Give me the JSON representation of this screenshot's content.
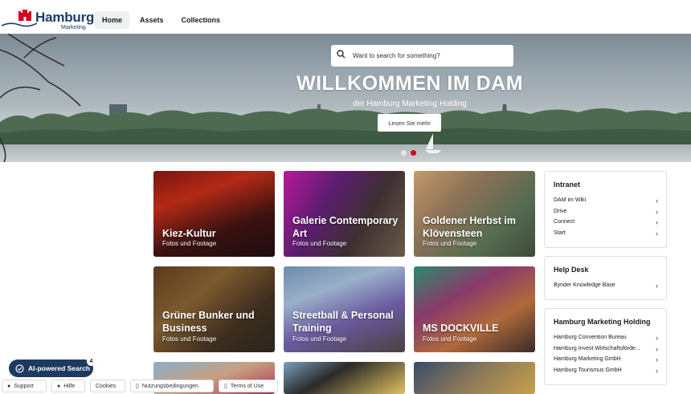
{
  "header": {
    "logo_text": "Hamburg",
    "logo_subtext": "Marketing",
    "nav": [
      {
        "label": "Home",
        "active": true
      },
      {
        "label": "Assets",
        "active": false
      },
      {
        "label": "Collections",
        "active": false
      }
    ]
  },
  "hero": {
    "search_placeholder": "Want to search for something?",
    "title": "WILLKOMMEN IM DAM",
    "subtitle": "der Hamburg Marketing Holding",
    "button_label": "Lesen Sie mehr",
    "carousel_dots": 2,
    "active_dot": 2
  },
  "cards": [
    {
      "title": "Kiez-Kultur",
      "subtitle": "Fotos und Footage"
    },
    {
      "title": "Galerie Contemporary Art",
      "subtitle": "Fotos und Footage"
    },
    {
      "title": "Goldener Herbst im Klövensteen",
      "subtitle": "Fotos und Footage"
    },
    {
      "title": "Grüner Bunker und Business",
      "subtitle": "Fotos und Footage"
    },
    {
      "title": "Streetball & Personal Training",
      "subtitle": "Fotos und Footage"
    },
    {
      "title": "MS DOCKVILLE",
      "subtitle": "Fotos und Footage"
    }
  ],
  "sidebar": {
    "intranet": {
      "title": "Intranet",
      "items": [
        "DAM im Wiki",
        "Drive",
        "Connect",
        "Start"
      ]
    },
    "helpdesk": {
      "title": "Help Desk",
      "items": [
        "Bynder Knowledge Base"
      ]
    },
    "holding": {
      "title": "Hamburg Marketing Holding",
      "items": [
        "Hamburg Convention Bureau",
        "Hamburg Invest Wirtschaftsförde...",
        "Hamburg Marketing GmbH",
        "Hamburg Tourismus GmbH"
      ]
    }
  },
  "ai_search": {
    "label": "AI-powered Search",
    "badge": "4"
  },
  "footer": {
    "links": [
      "Support",
      "Hilfe",
      "Cookies",
      "Nutzungsbedingungen",
      "Terms of Use"
    ]
  },
  "colors": {
    "brand_blue": "#1d3a6e",
    "accent_red": "#d7001e",
    "ai_button": "#1d3a5f"
  }
}
